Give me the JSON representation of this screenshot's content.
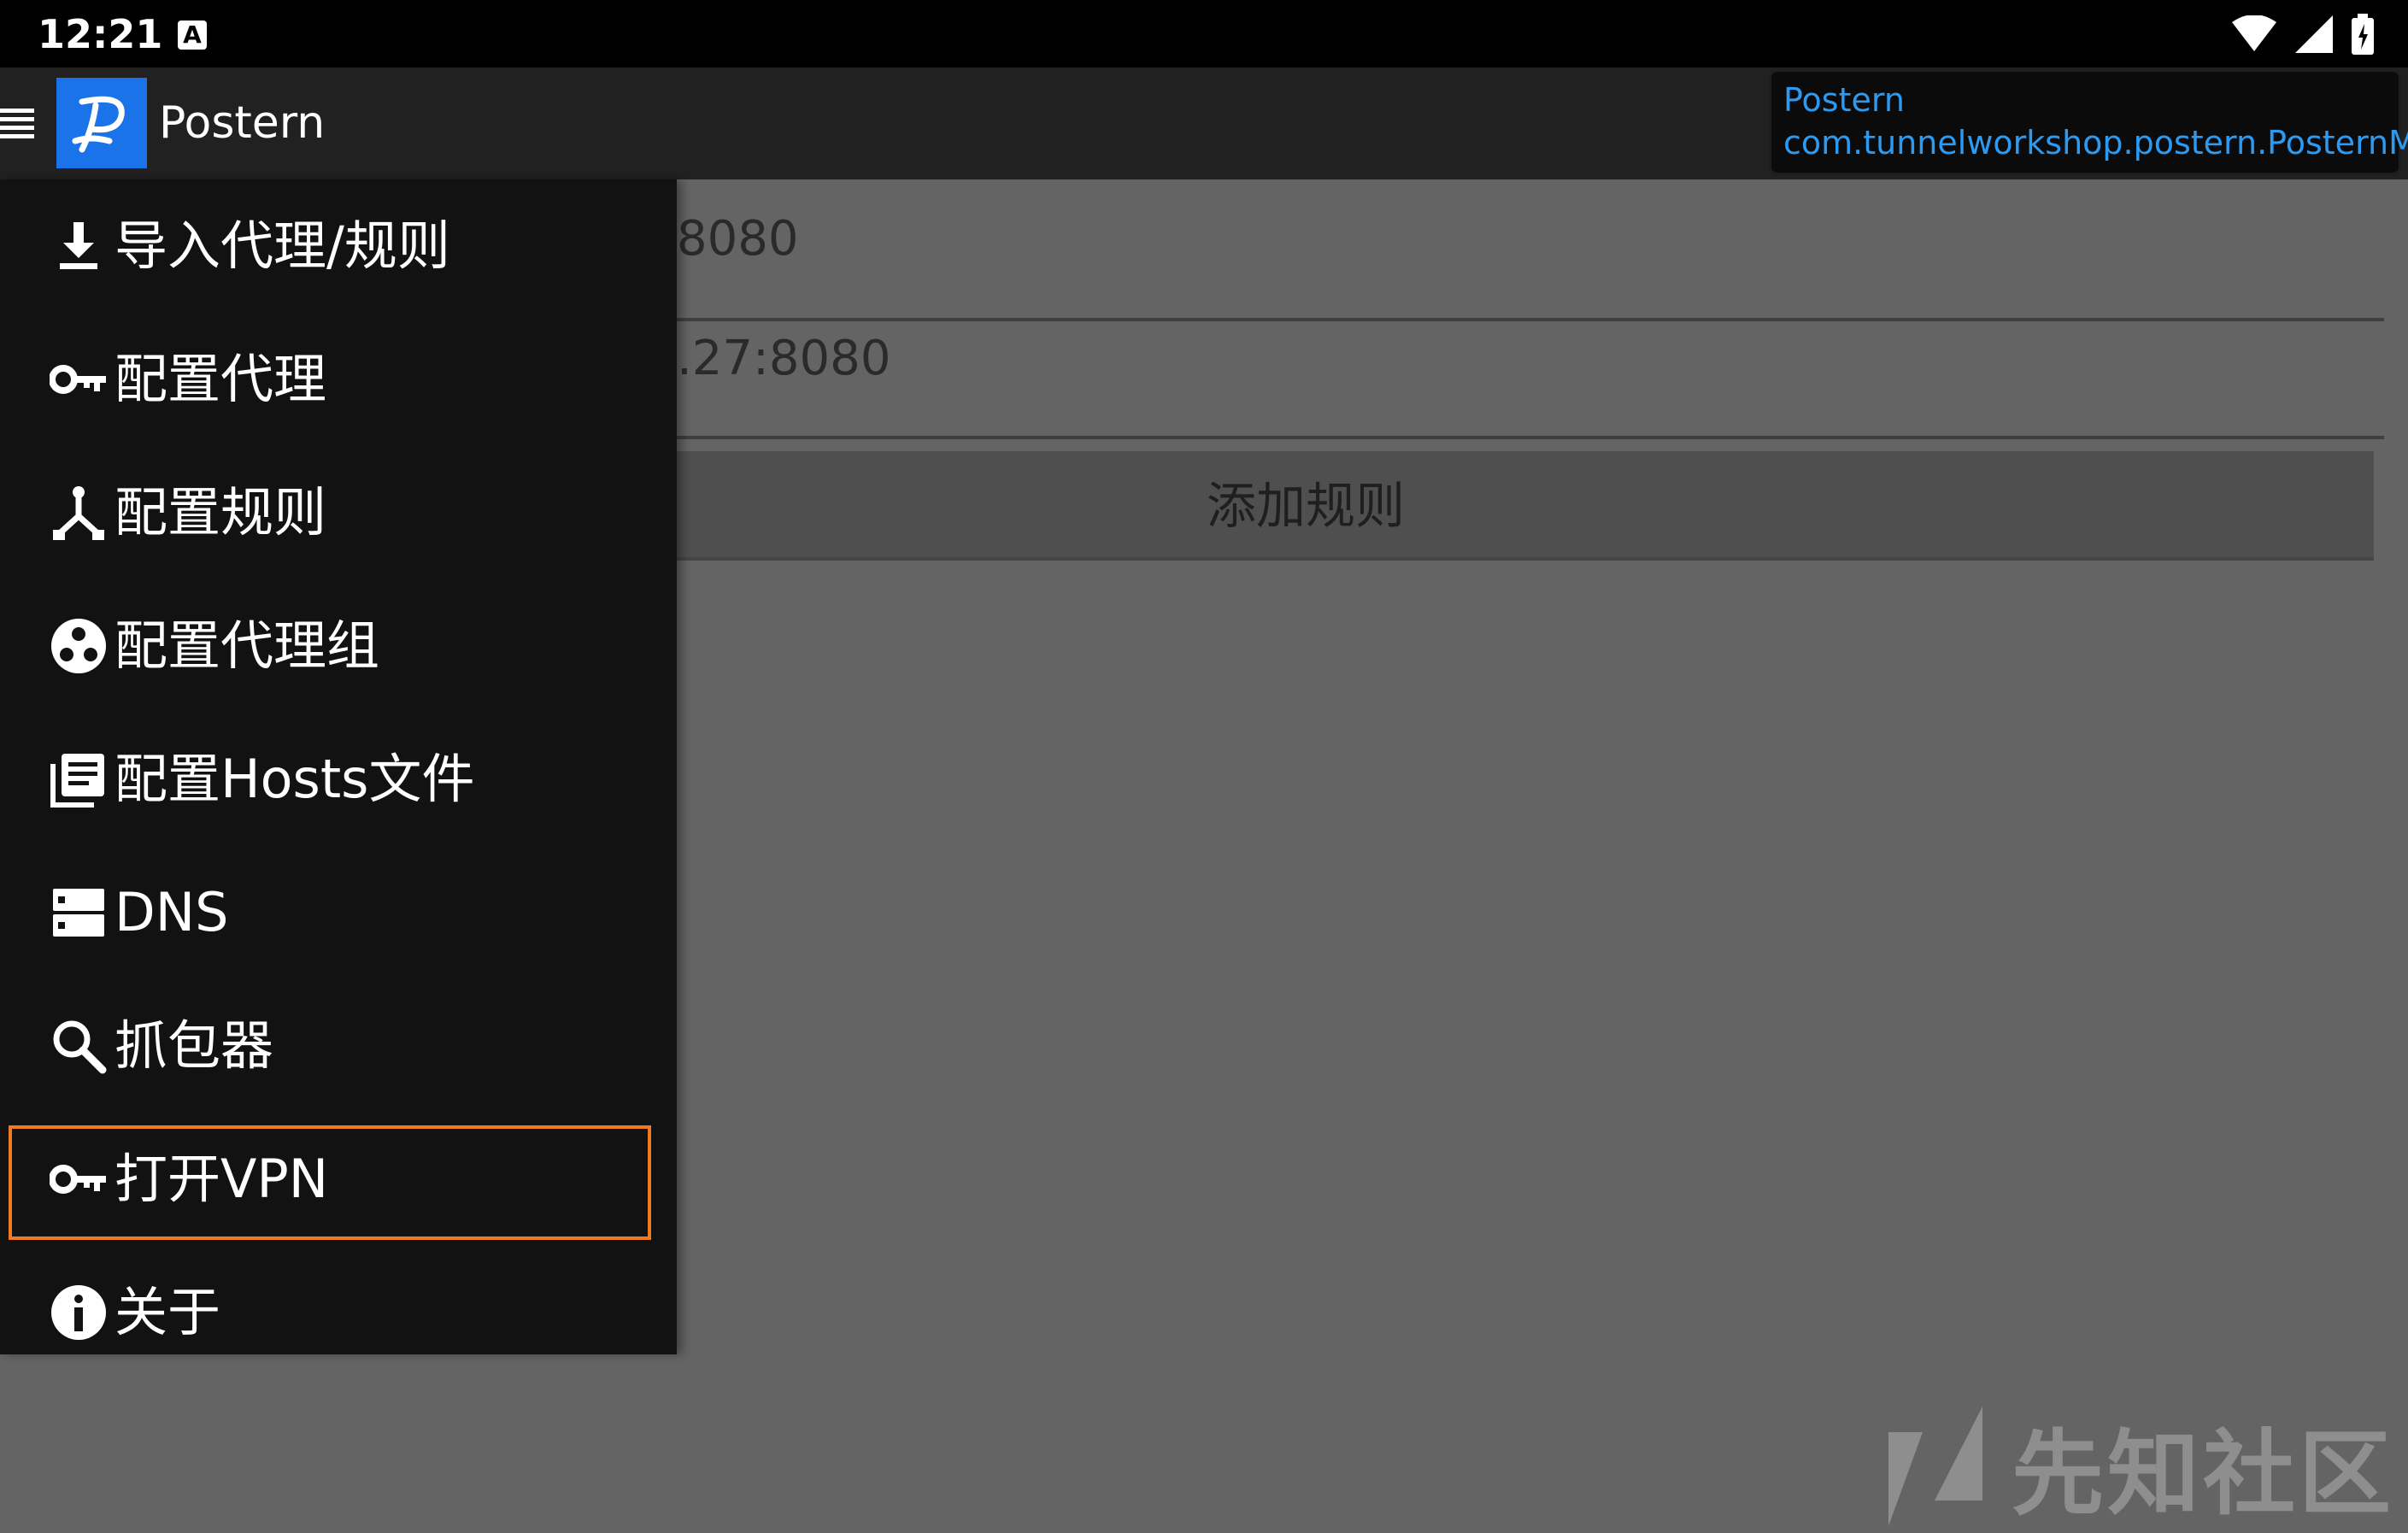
{
  "status_bar": {
    "time": "12:21",
    "notification_icon": "A",
    "icons": [
      "wifi-icon",
      "signal-icon",
      "battery-icon"
    ]
  },
  "toolbar": {
    "title": "Postern",
    "logo_letter": "P",
    "activity": {
      "app_name": "Postern",
      "component": "com.tunnelworkshop.postern.PosternMain"
    }
  },
  "main": {
    "row1_value": "8080",
    "row2_value": ".27:8080",
    "add_rule_label": "添加规则"
  },
  "drawer": {
    "items": [
      {
        "label": "导入代理/规则",
        "icon": "download-icon"
      },
      {
        "label": "配置代理",
        "icon": "key-icon"
      },
      {
        "label": "配置规则",
        "icon": "fork-icon"
      },
      {
        "label": "配置代理组",
        "icon": "group-icon"
      },
      {
        "label": "配置Hosts文件",
        "icon": "library-icon"
      },
      {
        "label": "DNS",
        "icon": "dns-icon"
      },
      {
        "label": "抓包器",
        "icon": "search-icon"
      },
      {
        "label": "打开VPN",
        "icon": "key-icon"
      },
      {
        "label": "关于",
        "icon": "info-icon"
      }
    ],
    "highlighted_item": "打开VPN"
  },
  "watermark": {
    "text": "先知社区"
  },
  "colors": {
    "accent_highlight": "#f07b22",
    "tooltip_text": "#2b9af3",
    "logo_bg": "#1a73e8",
    "drawer_bg": "#121212"
  }
}
